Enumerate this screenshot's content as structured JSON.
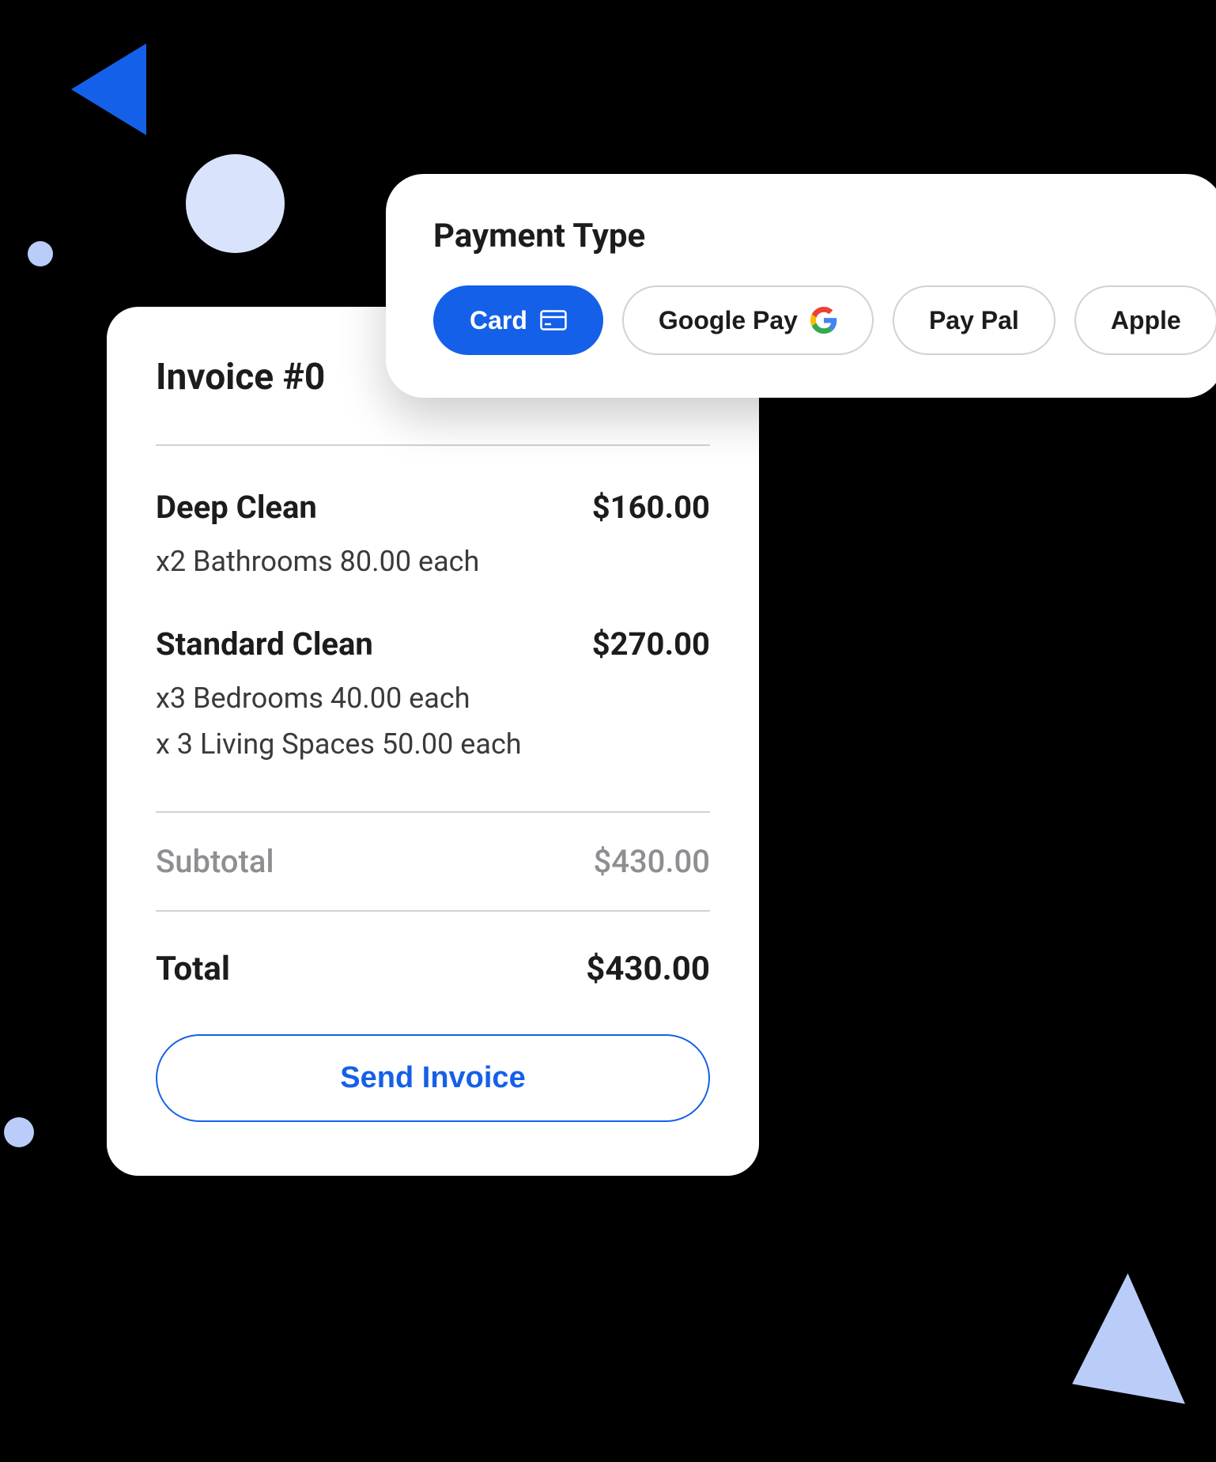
{
  "invoice": {
    "title": "Invoice #0",
    "items": [
      {
        "name": "Deep Clean",
        "price": "$160.00",
        "details": [
          "x2 Bathrooms 80.00 each"
        ]
      },
      {
        "name": "Standard Clean",
        "price": "$270.00",
        "details": [
          "x3 Bedrooms 40.00 each",
          "x 3 Living Spaces 50.00 each"
        ]
      }
    ],
    "subtotal_label": "Subtotal",
    "subtotal_value": "$430.00",
    "total_label": "Total",
    "total_value": "$430.00",
    "send_button": "Send Invoice"
  },
  "payment": {
    "title": "Payment Type",
    "options": [
      {
        "label": "Card",
        "icon": "credit-card",
        "active": true
      },
      {
        "label": "Google Pay",
        "icon": "google",
        "active": false
      },
      {
        "label": "Pay Pal",
        "icon": null,
        "active": false
      },
      {
        "label": "Apple",
        "icon": null,
        "active": false
      }
    ]
  },
  "colors": {
    "accent": "#1560E8",
    "light_blue": "#B9CDF8",
    "pale_blue": "#D9E3FB"
  }
}
